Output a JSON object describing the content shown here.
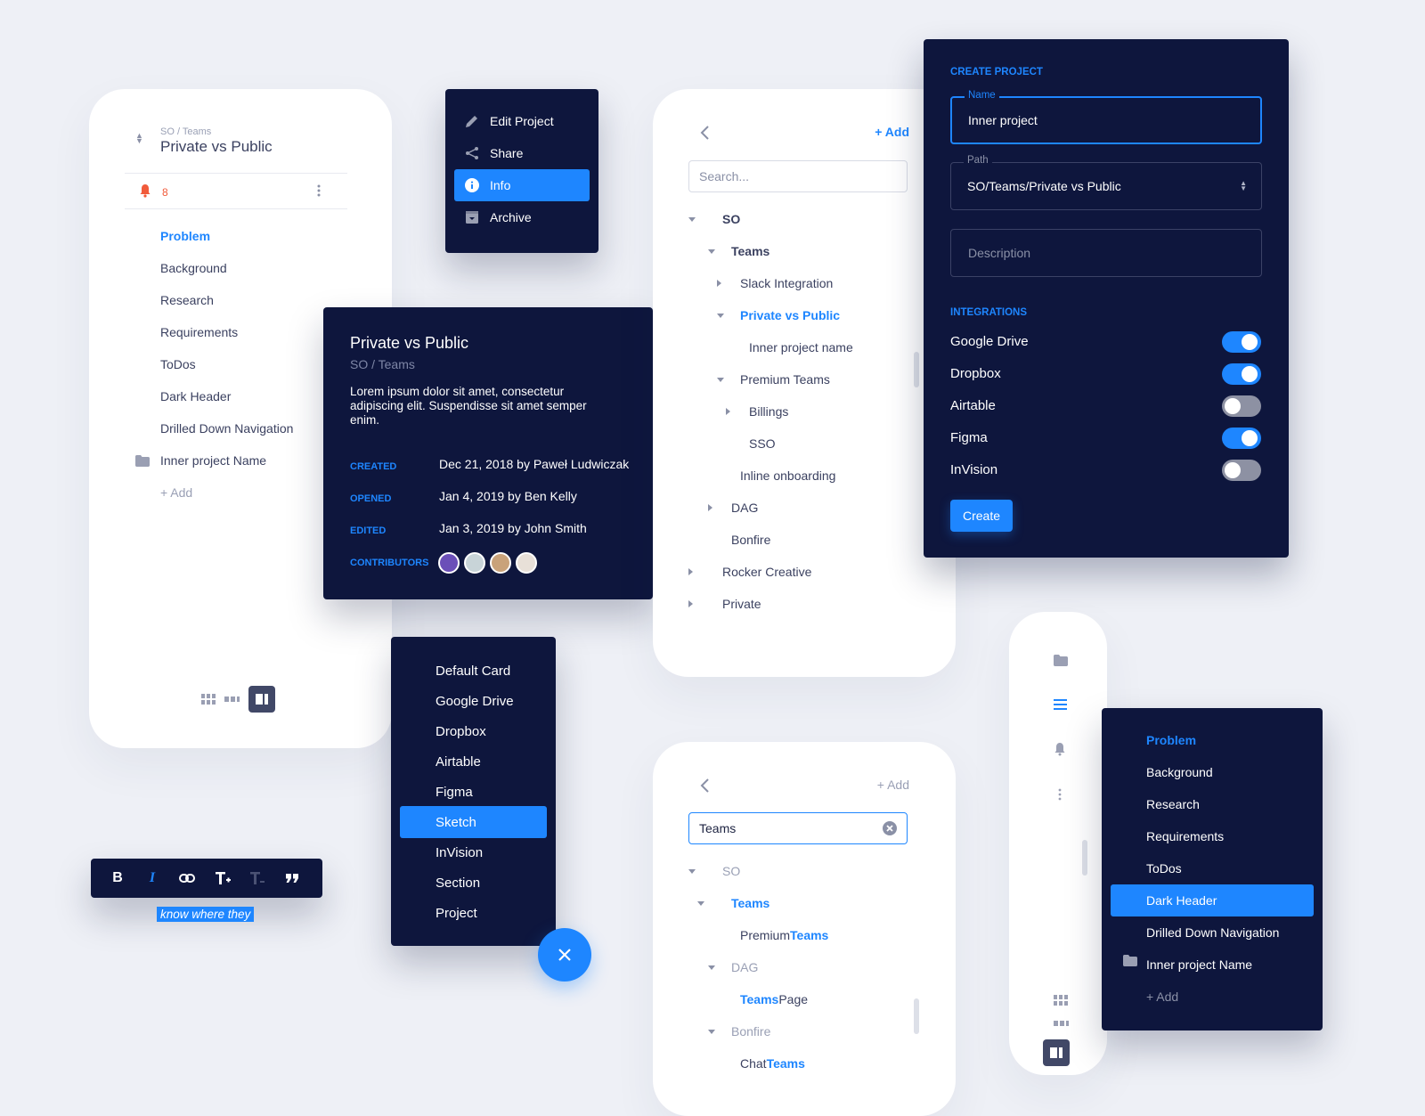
{
  "left_card": {
    "breadcrumb": "SO / Teams",
    "title": "Private vs Public",
    "notification_count": "8",
    "items": [
      {
        "label": "Problem",
        "active": true
      },
      {
        "label": "Background"
      },
      {
        "label": "Research"
      },
      {
        "label": "Requirements"
      },
      {
        "label": "ToDos"
      },
      {
        "label": "Dark Header"
      },
      {
        "label": "Drilled Down Navigation"
      },
      {
        "label": "Inner project Name",
        "icon": "folder-icon"
      },
      {
        "label": "+ Add"
      }
    ]
  },
  "context_menu": {
    "items": [
      {
        "label": "Edit Project",
        "icon": "pencil-icon"
      },
      {
        "label": "Share",
        "icon": "share-icon"
      },
      {
        "label": "Info",
        "icon": "info-icon",
        "active": true
      },
      {
        "label": "Archive",
        "icon": "archive-icon"
      }
    ]
  },
  "info_card": {
    "title": "Private vs Public",
    "subtitle": "SO / Teams",
    "description": "Lorem ipsum dolor sit amet, consectetur adipiscing elit. Suspendisse sit amet semper enim.",
    "meta": [
      {
        "label": "CREATED",
        "value": "Dec 21, 2018 by Paweł Ludwiczak"
      },
      {
        "label": "OPENED",
        "value": "Jan 4, 2019 by Ben Kelly"
      },
      {
        "label": "EDITED",
        "value": "Jan 3, 2019 by John Smith"
      }
    ],
    "contributors_label": "CONTRIBUTORS",
    "contributors": [
      "#6b4fb8",
      "#c8d4d8",
      "#c9a27a",
      "#e8e0d8"
    ]
  },
  "tree_card": {
    "add_label": "+ Add",
    "search_placeholder": "Search...",
    "items": [
      {
        "label": "SO",
        "caret": "down",
        "bold": true
      },
      {
        "label": "Teams",
        "caret": "down",
        "bold": true
      },
      {
        "label": "Slack Integration",
        "caret": "right"
      },
      {
        "label": "Private vs Public",
        "caret": "down",
        "active": true
      },
      {
        "label": "Inner project name"
      },
      {
        "label": "Premium Teams",
        "caret": "down"
      },
      {
        "label": "Billings",
        "caret": "right"
      },
      {
        "label": "SSO"
      },
      {
        "label": "Inline onboarding"
      },
      {
        "label": "DAG",
        "caret": "right"
      },
      {
        "label": "Bonfire"
      },
      {
        "label": "Rocker Creative",
        "caret": "right"
      },
      {
        "label": "Private",
        "caret": "right"
      }
    ]
  },
  "create_project": {
    "heading": "CREATE PROJECT",
    "name_label": "Name",
    "name_value": "Inner project",
    "path_label": "Path",
    "path_value": "SO/Teams/Private vs Public",
    "description_placeholder": "Description",
    "integrations_heading": "INTEGRATIONS",
    "integrations": [
      {
        "label": "Google Drive",
        "enabled": true
      },
      {
        "label": "Dropbox",
        "enabled": true
      },
      {
        "label": "Airtable",
        "enabled": false
      },
      {
        "label": "Figma",
        "enabled": true
      },
      {
        "label": "InVision",
        "enabled": false
      }
    ],
    "create_label": "Create"
  },
  "insert_menu": {
    "items": [
      {
        "label": "Default Card"
      },
      {
        "label": "Google Drive"
      },
      {
        "label": "Dropbox"
      },
      {
        "label": "Airtable"
      },
      {
        "label": "Figma"
      },
      {
        "label": "Sketch",
        "active": true
      },
      {
        "label": "InVision"
      },
      {
        "label": "Section"
      },
      {
        "label": "Project"
      }
    ]
  },
  "text_toolbar": {
    "buttons": [
      "bold",
      "italic",
      "link",
      "text-size-increase",
      "text-size-decrease",
      "quote"
    ],
    "bold_glyph": "B",
    "italic_glyph": "I",
    "selected_text": "know where they"
  },
  "filter_card": {
    "add_label": "+ Add",
    "search_value": "Teams",
    "items": [
      {
        "pre": "SO",
        "hl": "",
        "post": "",
        "caret": "down",
        "muted": true
      },
      {
        "pre": "",
        "hl": "Teams",
        "post": "",
        "caret": "down"
      },
      {
        "pre": "Premium ",
        "hl": "Teams",
        "post": ""
      },
      {
        "pre": "DAG",
        "hl": "",
        "post": "",
        "caret": "down",
        "muted": true
      },
      {
        "pre": "",
        "hl": "Teams",
        "post": " Page"
      },
      {
        "pre": "Bonfire",
        "hl": "",
        "post": "",
        "caret": "down",
        "muted": true
      },
      {
        "pre": "Chat ",
        "hl": "Teams",
        "post": ""
      }
    ]
  },
  "dark_nav": {
    "items": [
      {
        "label": "Problem",
        "style": "blue"
      },
      {
        "label": "Background"
      },
      {
        "label": "Research"
      },
      {
        "label": "Requirements"
      },
      {
        "label": "ToDos"
      },
      {
        "label": "Dark Header",
        "style": "active"
      },
      {
        "label": "Drilled Down Navigation"
      },
      {
        "label": "Inner project Name",
        "icon": "folder-icon"
      },
      {
        "label": "+ Add",
        "style": "muted"
      }
    ]
  },
  "colors": {
    "accent": "#1e86ff",
    "dark_bg": "#0e163d",
    "alert": "#f15b3b",
    "page_bg": "#eef0f6"
  }
}
